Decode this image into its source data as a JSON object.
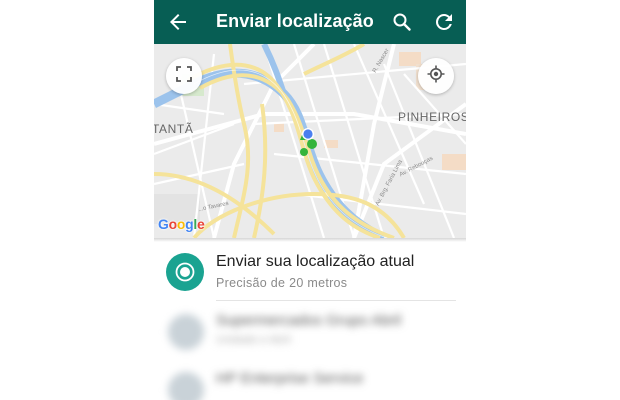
{
  "app_bar": {
    "title": "Enviar localização",
    "background": "#075e54",
    "icons": [
      "back-arrow-icon",
      "search-icon",
      "refresh-icon"
    ]
  },
  "map": {
    "labels": {
      "pinheiros": "PINHEIROS",
      "tanta": "TANTÃ",
      "street_nascer": "R. Nascer",
      "street_reboucas": "Av. Rebouças",
      "street_faria_lima": "Av. Brg. Faria Lima",
      "street_tavares": "...o Tavares"
    },
    "attribution_letters": [
      "G",
      "o",
      "o",
      "g",
      "l",
      "e"
    ],
    "icons": [
      "fullscreen-icon",
      "my-location-icon"
    ],
    "colors": {
      "road": "#f7e9a4",
      "river": "#8fb9e6",
      "park": "#cfe6c5",
      "marker": "#34b43c",
      "user_dot": "#4a7ff0"
    }
  },
  "send_current": {
    "title": "Enviar sua localização atual",
    "subtitle": "Precisão de 20 metros",
    "accent": "#1aa391"
  },
  "nearby_places": [
    {
      "name": "Supermercados Grupo Abril",
      "address": "Unidade e Abril"
    },
    {
      "name": "HP Enterprise Service",
      "address": ""
    }
  ]
}
